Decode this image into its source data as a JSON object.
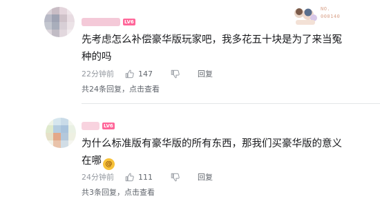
{
  "comments": [
    {
      "level": "LV6",
      "text": "先考虑怎么补偿豪华版玩家吧，我多花五十块是为了来当冤种的吗",
      "time": "22分钟前",
      "likes": "147",
      "reply": "回复",
      "replies_summary": "共24条回复，",
      "replies_link": "点击查看",
      "badge_number": "NO.\n000140"
    },
    {
      "level": "LV6",
      "text": "为什么标准版有豪华版的所有东西，那我们买豪华版的意义在哪",
      "time": "24分钟前",
      "likes": "111",
      "reply": "回复",
      "replies_summary": "共3条回复，",
      "replies_link": "点击查看"
    }
  ],
  "icons": {
    "like": "thumbs-up-icon",
    "dislike": "thumbs-down-icon",
    "emoji": "dizzy-face-emoji-icon"
  },
  "colors": {
    "level_badge": "#ff6699",
    "meta_text": "#9499a0",
    "body_text": "#18191c"
  }
}
